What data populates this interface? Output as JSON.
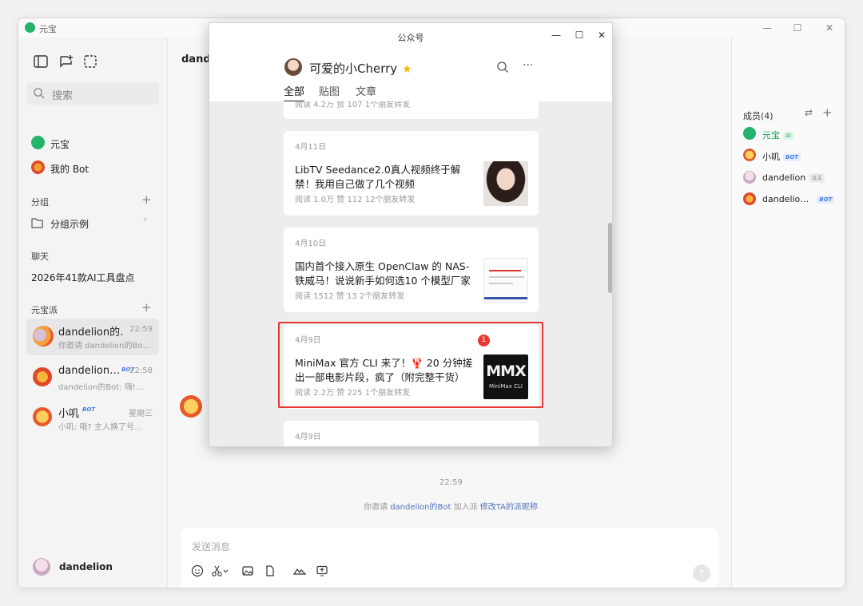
{
  "app": {
    "title": "元宝"
  },
  "sidebar": {
    "search_placeholder": "搜索",
    "nav": [
      {
        "label": "元宝"
      },
      {
        "label": "我的 Bot"
      }
    ],
    "groups_title": "分组",
    "group_item": "分组示例",
    "chat_title": "聊天",
    "chat_item": "2026年41款AI工具盘点",
    "pai_title": "元宝派",
    "chats": [
      {
        "name": "dandelion的…",
        "time": "22:59",
        "msg": "你邀请 dandelion的Bo…"
      },
      {
        "name": "dandelion…",
        "badge": "BOT",
        "time": "22:58",
        "msg": "dandelion的Bot: 嗨!…"
      },
      {
        "name": "小叽",
        "badge": "BOT",
        "time": "星期三",
        "msg": "小叽: 哦? 主人换了号…"
      }
    ],
    "user": "dandelion"
  },
  "main": {
    "title": "dande",
    "time": "22:59",
    "system_msg": {
      "prefix": "你邀请",
      "bot": "dandelion的Bot",
      "mid": "加入派",
      "action": "修改TA的派昵称"
    },
    "composer_placeholder": "发送消息"
  },
  "members": {
    "title": "成员(4)",
    "list": [
      {
        "name": "元宝",
        "tag": "AI"
      },
      {
        "name": "小叽",
        "tag": "BOT"
      },
      {
        "name": "dandelion",
        "tag": "派主"
      },
      {
        "name": "dandelio…",
        "tag": "BOT"
      }
    ]
  },
  "popup": {
    "window_title": "公众号",
    "account_name": "可爱的小Cherry",
    "tabs": [
      "全部",
      "贴图",
      "文章"
    ],
    "partial_meta": "阅读 4.2万  赞 107  1个朋友转发",
    "articles": [
      {
        "date": "4月11日",
        "title": "LibTV Seedance2.0真人视频终于解禁！我用自己做了几个视频",
        "meta": "阅读 1.0万  赞 112  12个朋友转发"
      },
      {
        "date": "4月10日",
        "title": "国内首个接入原生 OpenClaw 的 NAS-铁威马！说说新手如何选10 个模型厂家",
        "meta": "阅读 1512  赞 13  2个朋友转发"
      },
      {
        "date": "4月9日",
        "title": "MiniMax 官方 CLI 来了！🦞 20 分钟搓出一部电影片段，疯了（附完整干货）",
        "meta": "阅读 2.2万  赞 225  1个朋友转发",
        "thumb_text": "MMX",
        "thumb_sub": "MiniMax CLI",
        "badge": "1"
      },
      {
        "date": "4月9日"
      }
    ]
  },
  "colors": {
    "accent_green": "#24b36b",
    "highlight_red": "#e53935",
    "link_blue": "#5070b8"
  }
}
